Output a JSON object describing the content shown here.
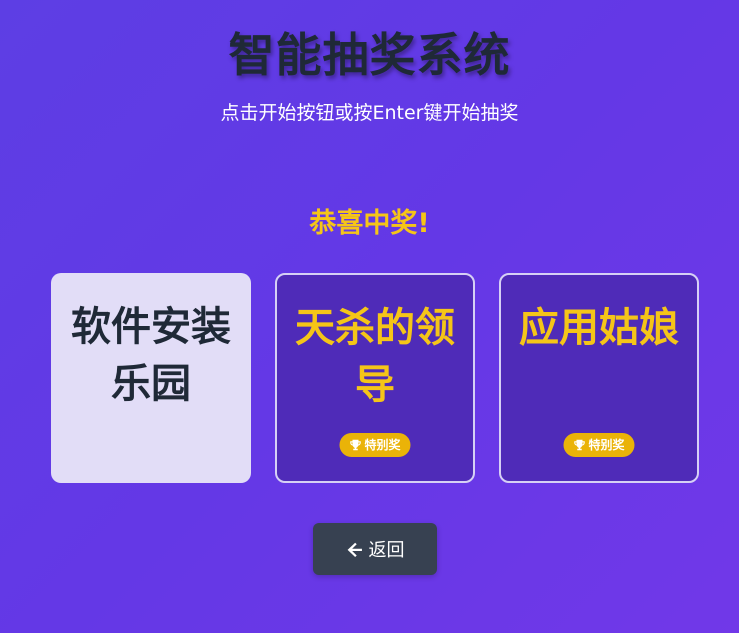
{
  "header": {
    "title": "智能抽奖系统",
    "subtitle": "点击开始按钮或按Enter键开始抽奖"
  },
  "result": {
    "heading": "恭喜中奖!",
    "cards": [
      {
        "name": "软件安装乐园",
        "winner": false,
        "badge": ""
      },
      {
        "name": "天杀的领导",
        "winner": true,
        "badge": "特别奖"
      },
      {
        "name": "应用姑娘",
        "winner": true,
        "badge": "特别奖"
      }
    ]
  },
  "actions": {
    "back_label": "返回",
    "back_icon": "arrow-left-icon"
  },
  "colors": {
    "background": "#6438e6",
    "title": "#1f2937",
    "accent_gold": "#f5c518",
    "badge": "#eab308",
    "winner_card": "#4f2bb8",
    "plain_card": "#e2ddf7",
    "button": "#374151"
  }
}
